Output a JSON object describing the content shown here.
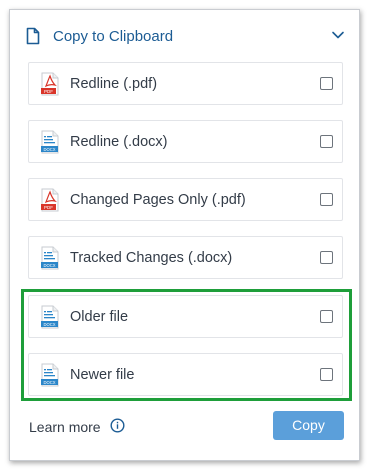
{
  "header": {
    "title": "Copy to Clipboard"
  },
  "items": [
    {
      "label": "Redline (.pdf)",
      "icon": "pdf-file-icon"
    },
    {
      "label": "Redline (.docx)",
      "icon": "docx-file-icon"
    },
    {
      "label": "Changed Pages Only (.pdf)",
      "icon": "pdf-file-icon"
    },
    {
      "label": "Tracked Changes (.docx)",
      "icon": "docx-file-icon"
    },
    {
      "label": "Older file",
      "icon": "docx-file-icon"
    },
    {
      "label": "Newer file",
      "icon": "docx-file-icon"
    }
  ],
  "icon_badges": {
    "pdf": "PDF",
    "docx": "DOCX"
  },
  "footer": {
    "learn_more": "Learn more",
    "copy_label": "Copy"
  },
  "colors": {
    "accent": "#1c5c94",
    "button": "#5b9fda",
    "highlight": "#1e9e3a",
    "pdf": "#d9352a",
    "docx": "#2b86c9"
  }
}
